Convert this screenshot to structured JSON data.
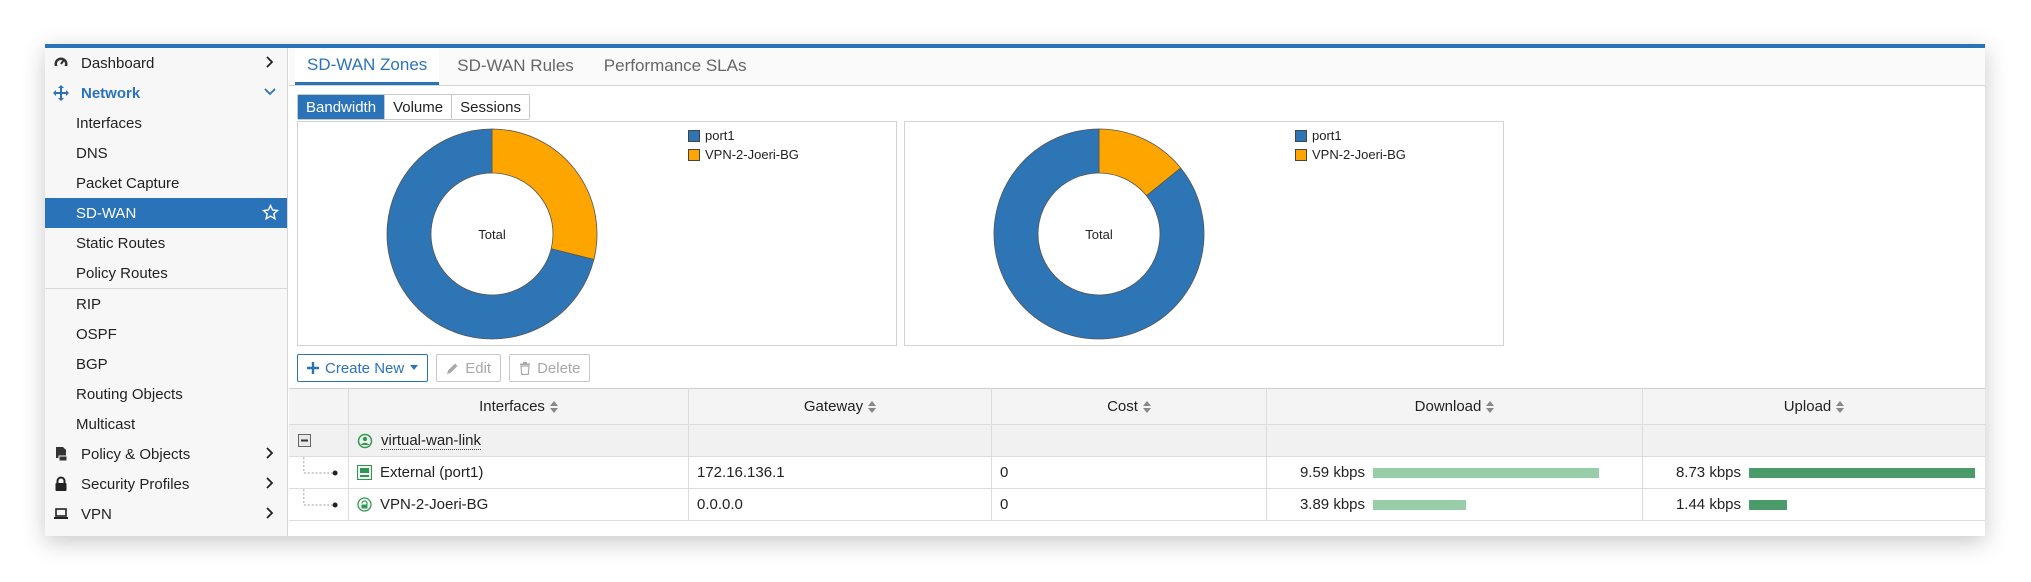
{
  "sidebar": {
    "items": [
      {
        "label": "Dashboard",
        "icon": "dashboard-icon",
        "type": "top",
        "chevron": "right"
      },
      {
        "label": "Network",
        "icon": "network-icon",
        "type": "top-active",
        "chevron": "down"
      },
      {
        "label": "Interfaces",
        "type": "sub"
      },
      {
        "label": "DNS",
        "type": "sub"
      },
      {
        "label": "Packet Capture",
        "type": "sub"
      },
      {
        "label": "SD-WAN",
        "type": "sub-selected"
      },
      {
        "label": "Static Routes",
        "type": "sub"
      },
      {
        "label": "Policy Routes",
        "type": "sub"
      },
      {
        "label": "RIP",
        "type": "sub"
      },
      {
        "label": "OSPF",
        "type": "sub"
      },
      {
        "label": "BGP",
        "type": "sub"
      },
      {
        "label": "Routing Objects",
        "type": "sub"
      },
      {
        "label": "Multicast",
        "type": "sub"
      },
      {
        "label": "Policy & Objects",
        "icon": "policy-icon",
        "type": "top",
        "chevron": "right"
      },
      {
        "label": "Security Profiles",
        "icon": "lock-icon",
        "type": "top",
        "chevron": "right"
      },
      {
        "label": "VPN",
        "icon": "laptop-icon",
        "type": "top",
        "chevron": "right"
      }
    ]
  },
  "tabs": [
    "SD-WAN Zones",
    "SD-WAN Rules",
    "Performance SLAs"
  ],
  "toggles": [
    "Bandwidth",
    "Volume",
    "Sessions"
  ],
  "colors": {
    "accent": "#2a73b9",
    "port1": "#2e75b6",
    "vpn": "#ffa500"
  },
  "chart_data": [
    {
      "type": "pie",
      "center_label": "Total",
      "categories": [
        "port1",
        "VPN-2-Joeri-BG"
      ],
      "values": [
        71.1,
        28.9
      ]
    },
    {
      "type": "pie",
      "center_label": "Total",
      "categories": [
        "port1",
        "VPN-2-Joeri-BG"
      ],
      "values": [
        85.8,
        14.2
      ]
    }
  ],
  "toolbar": {
    "create_new": "Create New",
    "edit": "Edit",
    "delete": "Delete"
  },
  "table": {
    "columns": [
      "Interfaces",
      "Gateway",
      "Cost",
      "Download",
      "Upload"
    ],
    "group": "virtual-wan-link",
    "rows": [
      {
        "interface": "External (port1)",
        "gateway": "172.16.136.1",
        "cost": "0",
        "download": "9.59 kbps",
        "upload": "8.73 kbps",
        "download_level": 1.0,
        "upload_level": 1.0
      },
      {
        "interface": "VPN-2-Joeri-BG",
        "gateway": "0.0.0.0",
        "cost": "0",
        "download": "3.89 kbps",
        "upload": "1.44 kbps",
        "download_level": 0.41,
        "upload_level": 0.17
      }
    ]
  }
}
